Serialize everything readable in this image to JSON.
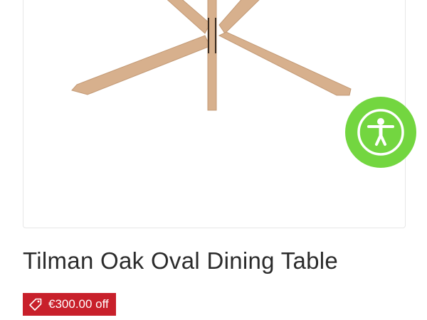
{
  "product": {
    "image_alt": "Tilman Oak Oval Dining Table",
    "title": "Tilman Oak Oval Dining Table",
    "discount_label": "€300.00 off"
  },
  "accessibility": {
    "button_label": "Accessibility",
    "icon": "accessibility-person-icon"
  },
  "colors": {
    "accent_green": "#73d640",
    "badge_red": "#c8202b",
    "title_text": "#2b2b2b",
    "wood": "#d8b392"
  },
  "icons": {
    "badge": "price-tag-icon"
  }
}
